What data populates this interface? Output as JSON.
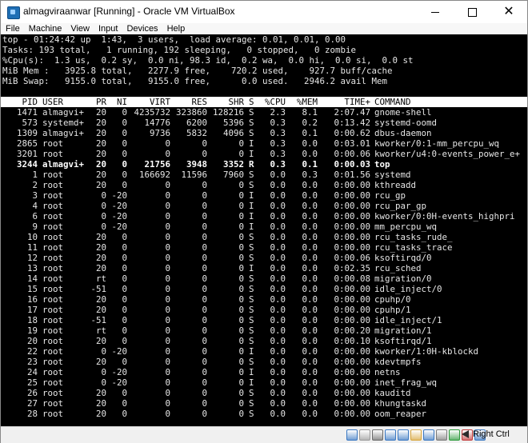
{
  "window": {
    "title": "almagviraanwar [Running] - Oracle VM VirtualBox",
    "controls": {
      "minimize": "—",
      "maximize": "☐",
      "close": "✕"
    }
  },
  "menubar": [
    "File",
    "Machine",
    "View",
    "Input",
    "Devices",
    "Help"
  ],
  "top": {
    "summary": [
      "top - 01:24:42 up  1:43,  3 users,  load average: 0.01, 0.01, 0.00",
      "Tasks: 193 total,   1 running, 192 sleeping,   0 stopped,   0 zombie",
      "%Cpu(s):  1.3 us,  0.2 sy,  0.0 ni, 98.3 id,  0.2 wa,  0.0 hi,  0.0 si,  0.0 st",
      "MiB Mem :   3925.8 total,   2277.9 free,    720.2 used,    927.7 buff/cache",
      "MiB Swap:   9155.0 total,   9155.0 free,      0.0 used.   2946.2 avail Mem"
    ],
    "columns": [
      "PID",
      "USER",
      "PR",
      "NI",
      "VIRT",
      "RES",
      "SHR",
      "S",
      "%CPU",
      "%MEM",
      "TIME+",
      "COMMAND"
    ],
    "processes": [
      [
        "1471",
        "almagvi+",
        "20",
        "0",
        "4235732",
        "323860",
        "128216",
        "S",
        "2.3",
        "8.1",
        "2:07.47",
        "gnome-shell"
      ],
      [
        "573",
        "systemd+",
        "20",
        "0",
        "14776",
        "6200",
        "5396",
        "S",
        "0.3",
        "0.2",
        "0:13.42",
        "systemd-oomd"
      ],
      [
        "1309",
        "almagvi+",
        "20",
        "0",
        "9736",
        "5832",
        "4096",
        "S",
        "0.3",
        "0.1",
        "0:00.62",
        "dbus-daemon"
      ],
      [
        "2865",
        "root",
        "20",
        "0",
        "0",
        "0",
        "0",
        "I",
        "0.3",
        "0.0",
        "0:03.01",
        "kworker/0:1-mm_percpu_wq"
      ],
      [
        "3201",
        "root",
        "20",
        "0",
        "0",
        "0",
        "0",
        "I",
        "0.3",
        "0.0",
        "0:00.06",
        "kworker/u4:0-events_power_e+"
      ],
      [
        "3244",
        "almagvi+",
        "20",
        "0",
        "21756",
        "3948",
        "3352",
        "R",
        "0.3",
        "0.1",
        "0:00.03",
        "top"
      ],
      [
        "1",
        "root",
        "20",
        "0",
        "166692",
        "11596",
        "7960",
        "S",
        "0.0",
        "0.3",
        "0:01.56",
        "systemd"
      ],
      [
        "2",
        "root",
        "20",
        "0",
        "0",
        "0",
        "0",
        "S",
        "0.0",
        "0.0",
        "0:00.00",
        "kthreadd"
      ],
      [
        "3",
        "root",
        "0",
        "-20",
        "0",
        "0",
        "0",
        "I",
        "0.0",
        "0.0",
        "0:00.00",
        "rcu_gp"
      ],
      [
        "4",
        "root",
        "0",
        "-20",
        "0",
        "0",
        "0",
        "I",
        "0.0",
        "0.0",
        "0:00.00",
        "rcu_par_gp"
      ],
      [
        "6",
        "root",
        "0",
        "-20",
        "0",
        "0",
        "0",
        "I",
        "0.0",
        "0.0",
        "0:00.00",
        "kworker/0:0H-events_highpri"
      ],
      [
        "9",
        "root",
        "0",
        "-20",
        "0",
        "0",
        "0",
        "I",
        "0.0",
        "0.0",
        "0:00.00",
        "mm_percpu_wq"
      ],
      [
        "10",
        "root",
        "20",
        "0",
        "0",
        "0",
        "0",
        "S",
        "0.0",
        "0.0",
        "0:00.00",
        "rcu_tasks_rude_"
      ],
      [
        "11",
        "root",
        "20",
        "0",
        "0",
        "0",
        "0",
        "S",
        "0.0",
        "0.0",
        "0:00.00",
        "rcu_tasks_trace"
      ],
      [
        "12",
        "root",
        "20",
        "0",
        "0",
        "0",
        "0",
        "S",
        "0.0",
        "0.0",
        "0:00.06",
        "ksoftirqd/0"
      ],
      [
        "13",
        "root",
        "20",
        "0",
        "0",
        "0",
        "0",
        "I",
        "0.0",
        "0.0",
        "0:02.35",
        "rcu_sched"
      ],
      [
        "14",
        "root",
        "rt",
        "0",
        "0",
        "0",
        "0",
        "S",
        "0.0",
        "0.0",
        "0:00.08",
        "migration/0"
      ],
      [
        "15",
        "root",
        "-51",
        "0",
        "0",
        "0",
        "0",
        "S",
        "0.0",
        "0.0",
        "0:00.00",
        "idle_inject/0"
      ],
      [
        "16",
        "root",
        "20",
        "0",
        "0",
        "0",
        "0",
        "S",
        "0.0",
        "0.0",
        "0:00.00",
        "cpuhp/0"
      ],
      [
        "17",
        "root",
        "20",
        "0",
        "0",
        "0",
        "0",
        "S",
        "0.0",
        "0.0",
        "0:00.00",
        "cpuhp/1"
      ],
      [
        "18",
        "root",
        "-51",
        "0",
        "0",
        "0",
        "0",
        "S",
        "0.0",
        "0.0",
        "0:00.00",
        "idle_inject/1"
      ],
      [
        "19",
        "root",
        "rt",
        "0",
        "0",
        "0",
        "0",
        "S",
        "0.0",
        "0.0",
        "0:00.20",
        "migration/1"
      ],
      [
        "20",
        "root",
        "20",
        "0",
        "0",
        "0",
        "0",
        "S",
        "0.0",
        "0.0",
        "0:00.10",
        "ksoftirqd/1"
      ],
      [
        "22",
        "root",
        "0",
        "-20",
        "0",
        "0",
        "0",
        "I",
        "0.0",
        "0.0",
        "0:00.00",
        "kworker/1:0H-kblockd"
      ],
      [
        "23",
        "root",
        "20",
        "0",
        "0",
        "0",
        "0",
        "S",
        "0.0",
        "0.0",
        "0:00.00",
        "kdevtmpfs"
      ],
      [
        "24",
        "root",
        "0",
        "-20",
        "0",
        "0",
        "0",
        "I",
        "0.0",
        "0.0",
        "0:00.00",
        "netns"
      ],
      [
        "25",
        "root",
        "0",
        "-20",
        "0",
        "0",
        "0",
        "I",
        "0.0",
        "0.0",
        "0:00.00",
        "inet_frag_wq"
      ],
      [
        "26",
        "root",
        "20",
        "0",
        "0",
        "0",
        "0",
        "S",
        "0.0",
        "0.0",
        "0:00.00",
        "kauditd"
      ],
      [
        "27",
        "root",
        "20",
        "0",
        "0",
        "0",
        "0",
        "S",
        "0.0",
        "0.0",
        "0:00.00",
        "khungtaskd"
      ],
      [
        "28",
        "root",
        "20",
        "0",
        "0",
        "0",
        "0",
        "S",
        "0.0",
        "0.0",
        "0:00.00",
        "oom_reaper"
      ]
    ],
    "running_pid": "3244"
  },
  "statusbar": {
    "host_key_label": "Right Ctrl",
    "icons": [
      "hard-disk-icon",
      "optical-drive-icon",
      "audio-icon",
      "network-icon",
      "usb-icon",
      "shared-folders-icon",
      "display-icon",
      "recording-icon",
      "cpu-icon",
      "mouse-integration-icon",
      "keyboard-icon"
    ],
    "icon_colors": [
      "#3a78c2",
      "#9a9a9a",
      "#6a6a6a",
      "#3a78c2",
      "#3a78c2",
      "#d7a53a",
      "#3a78c2",
      "#7a7a7a",
      "#2b9a3a",
      "#c23a3a",
      "#3a78c2"
    ]
  }
}
